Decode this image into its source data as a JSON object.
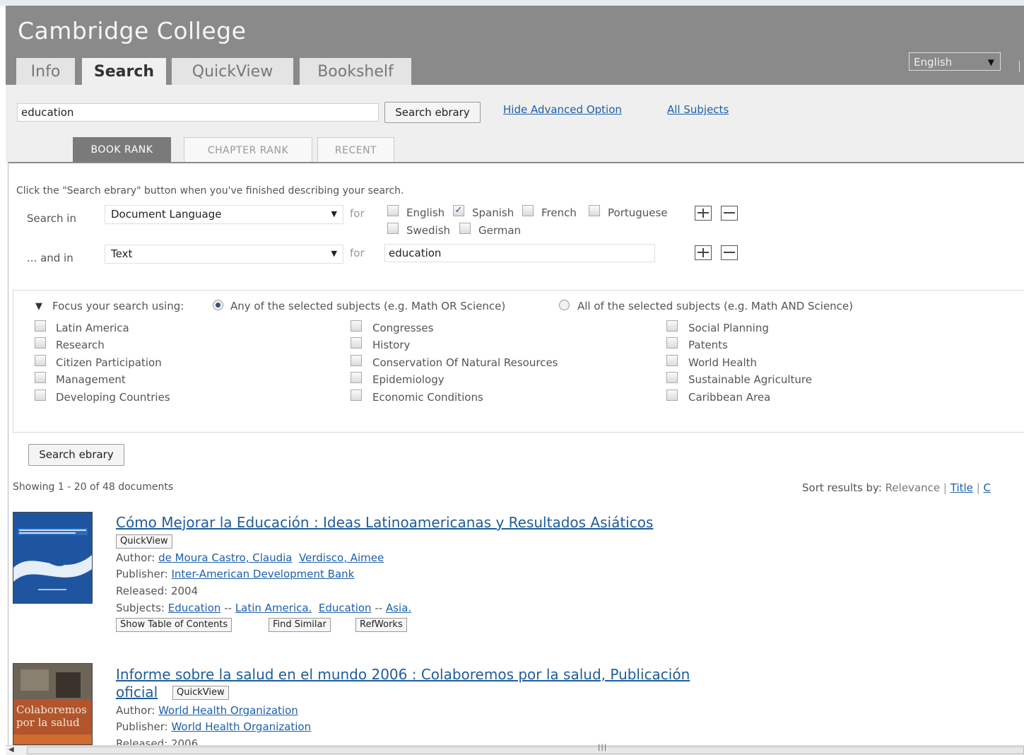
{
  "app_title": "Cambridge College",
  "main_tabs": [
    {
      "label": "Info",
      "active": false
    },
    {
      "label": "Search",
      "active": true
    },
    {
      "label": "QuickView",
      "active": false
    },
    {
      "label": "Bookshelf",
      "active": false
    }
  ],
  "language_select": {
    "value": "English"
  },
  "search": {
    "query": "education",
    "button": "Search ebrary",
    "hide_advanced": "Hide Advanced Option",
    "all_subjects": "All Subjects"
  },
  "rank_tabs": [
    {
      "label": "BOOK RANK",
      "active": true
    },
    {
      "label": "CHAPTER RANK",
      "active": false
    },
    {
      "label": "RECENT",
      "active": false
    }
  ],
  "advanced": {
    "instructions": "Click the \"Search ebrary\" button when you've finished describing your search.",
    "row1": {
      "label": "Search in",
      "field": "Document Language",
      "for": "for"
    },
    "row2": {
      "label": "... and in",
      "field": "Text",
      "for": "for",
      "value": "education"
    },
    "languages": [
      {
        "label": "English",
        "checked": false
      },
      {
        "label": "Spanish",
        "checked": true
      },
      {
        "label": "French",
        "checked": false
      },
      {
        "label": "Portuguese",
        "checked": false
      },
      {
        "label": "Swedish",
        "checked": false
      },
      {
        "label": "German",
        "checked": false
      }
    ]
  },
  "focus": {
    "label": "Focus your search using:",
    "any": "Any of the selected subjects (e.g. Math OR Science)",
    "all": "All of the selected subjects (e.g. Math AND Science)",
    "selected": "any",
    "subjects": [
      [
        "Latin America",
        "Research",
        "Citizen Participation",
        "Management",
        "Developing Countries"
      ],
      [
        "Congresses",
        "History",
        "Conservation Of Natural Resources",
        "Epidemiology",
        "Economic Conditions"
      ],
      [
        "Social Planning",
        "Patents",
        "World Health",
        "Sustainable Agriculture",
        "Caribbean Area"
      ]
    ]
  },
  "search_button2": "Search ebrary",
  "results_summary": "Showing 1 - 20 of 48 documents",
  "sort": {
    "label": "Sort results by:",
    "relevance": "Relevance",
    "sep": "|",
    "title": "Title",
    "cut": "C"
  },
  "results": [
    {
      "title": "Cómo Mejorar la Educación : Ideas Latinoamericanas y Resultados Asiáticos",
      "quickview": "QuickView",
      "author_label": "Author:",
      "authors": [
        "de Moura Castro, Claudia",
        "Verdisco, Aimee"
      ],
      "publisher_label": "Publisher:",
      "publisher": "Inter-American Development Bank",
      "released_label": "Released:",
      "released": "2004",
      "subjects_label": "Subjects:",
      "subjects": [
        "Education",
        "Latin America.",
        "Education",
        "Asia."
      ],
      "subject_sep": "--",
      "actions": [
        "Show Table of Contents",
        "Find Similar",
        "RefWorks"
      ]
    },
    {
      "title_line1": "Informe sobre la salud en el mundo 2006 : Colaboremos por la salud, Publicación",
      "title_line2": "oficial",
      "quickview": "QuickView",
      "author_label": "Author:",
      "author": "World Health Organization",
      "publisher_label": "Publisher:",
      "publisher": "World Health Organization",
      "released_partial": "Released: 2006",
      "cover_text": "Colaboremos por la salud"
    }
  ],
  "colors": {
    "header": "#8a8a8a",
    "link": "#1d5fa8",
    "active_rank": "#7a7a7a"
  }
}
